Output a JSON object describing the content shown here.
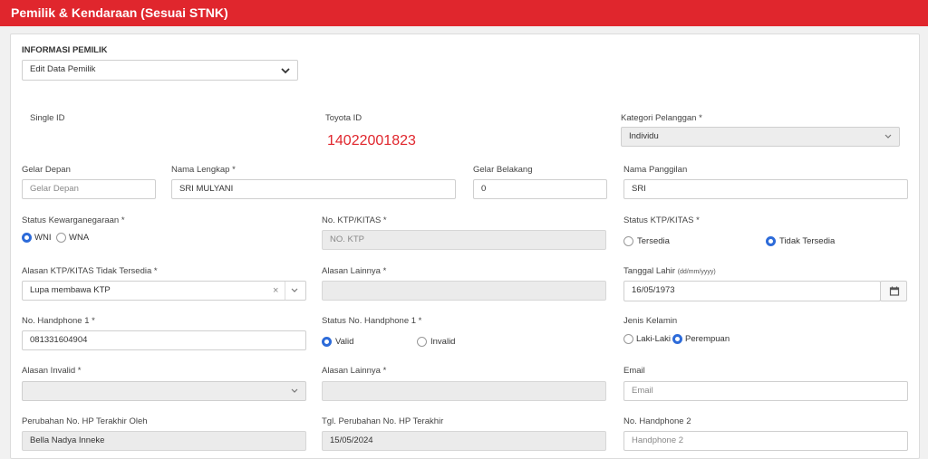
{
  "header": {
    "title": "Pemilik & Kendaraan (Sesuai STNK)"
  },
  "section": {
    "title": "INFORMASI PEMILIK"
  },
  "owner_select": {
    "value": "Edit Data Pemilik"
  },
  "single_id": {
    "label": "Single ID"
  },
  "toyota_id": {
    "label": "Toyota ID",
    "value": "14022001823"
  },
  "kategori": {
    "label": "Kategori Pelanggan *",
    "value": "Individu"
  },
  "gelar_depan": {
    "label": "Gelar Depan",
    "placeholder": "Gelar Depan"
  },
  "nama_lengkap": {
    "label": "Nama Lengkap *",
    "value": "SRI MULYANI"
  },
  "gelar_belakang": {
    "label": "Gelar Belakang",
    "value": "0"
  },
  "nama_panggilan": {
    "label": "Nama Panggilan",
    "value": "SRI"
  },
  "kewarganegaraan": {
    "label": "Status Kewarganegaraan *",
    "opt1": "WNI",
    "opt2": "WNA",
    "selected": "WNI"
  },
  "no_ktp": {
    "label": "No. KTP/KITAS *",
    "placeholder": "NO. KTP"
  },
  "status_ktp": {
    "label": "Status KTP/KITAS *",
    "opt1": "Tersedia",
    "opt2": "Tidak Tersedia",
    "selected": "Tidak Tersedia"
  },
  "alasan_ktp": {
    "label": "Alasan KTP/KITAS Tidak Tersedia *",
    "value": "Lupa membawa KTP",
    "clear": "×"
  },
  "alasan_lainnya1": {
    "label": "Alasan Lainnya *"
  },
  "tanggal_lahir": {
    "label": "Tanggal Lahir",
    "hint": "(dd/mm/yyyy)",
    "value": "16/05/1973"
  },
  "no_hp1": {
    "label": "No. Handphone 1 *",
    "value": "081331604904"
  },
  "status_hp1": {
    "label": "Status No. Handphone 1 *",
    "opt1": "Valid",
    "opt2": "Invalid",
    "selected": "Valid"
  },
  "jenis_kelamin": {
    "label": "Jenis Kelamin",
    "opt1": "Laki-Laki",
    "opt2": "Perempuan",
    "selected": "Perempuan"
  },
  "alasan_invalid": {
    "label": "Alasan Invalid *"
  },
  "alasan_lainnya2": {
    "label": "Alasan Lainnya *"
  },
  "email": {
    "label": "Email",
    "placeholder": "Email"
  },
  "perubahan_hp": {
    "label": "Perubahan No. HP Terakhir Oleh",
    "value": "Bella Nadya Inneke"
  },
  "tgl_perubahan": {
    "label": "Tgl. Perubahan No. HP Terakhir",
    "value": "15/05/2024"
  },
  "no_hp2": {
    "label": "No. Handphone 2",
    "placeholder": "Handphone 2"
  }
}
